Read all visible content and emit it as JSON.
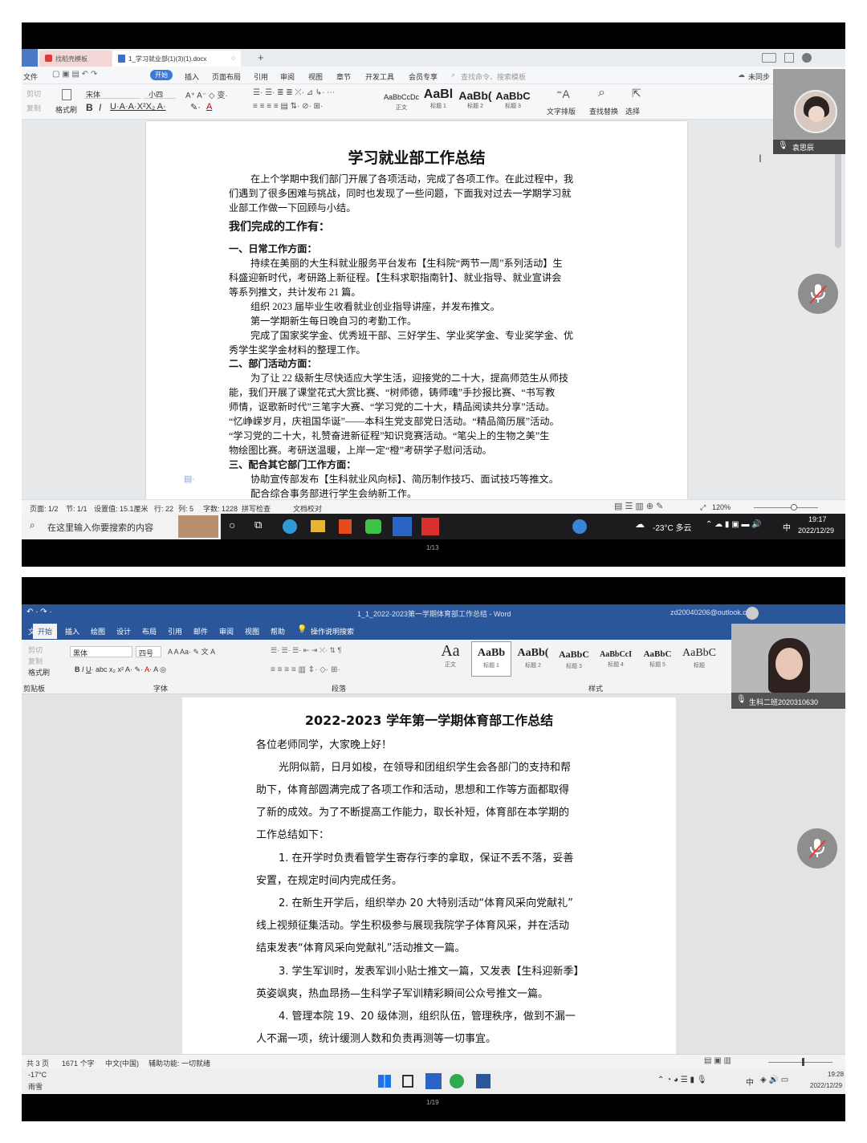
{
  "shot1": {
    "tabs": [
      {
        "label": "找稻壳模板",
        "icon": "wps-icon"
      },
      {
        "label": "1_学习就业部(1)(3)(1).docx",
        "icon": "doc-icon"
      }
    ],
    "add_tab": "+",
    "menu": [
      "文件",
      "开始",
      "插入",
      "页面布局",
      "引用",
      "审阅",
      "视图",
      "章节",
      "开发工具",
      "会员专享"
    ],
    "menu_search": "查找命令、搜索模板",
    "sync": "未同步",
    "font_name": "宋体",
    "font_size": "小四",
    "styles": [
      {
        "preview": "AaBbCcDc",
        "label": "正文"
      },
      {
        "preview": "AaBl",
        "label": "标题 1"
      },
      {
        "preview": "AaBb(",
        "label": "标题 2"
      },
      {
        "preview": "AaBbC",
        "label": "标题 3"
      }
    ],
    "tool_labels": {
      "text_layout": "文字排版",
      "find_replace": "查找替换",
      "select": "选择",
      "clipboard_cut": "剪切",
      "clipboard_copy": "复制",
      "format_brush": "格式刷"
    },
    "participant_name": "袁思辰",
    "doc": {
      "title": "学习就业部工作总结",
      "lines": [
        "在上个学期中我们部门开展了各项活动，完成了各项工作。在此过程中，我",
        "们遇到了很多困难与挑战，同时也发现了一些问题，下面我对过去一学期学习就",
        "业部工作做一下回顾与小结。",
        "我们完成的工作有：",
        "一、日常工作方面：",
        "持续在美丽的大生科就业服务平台发布【生科院“两节一周”系列活动】生",
        "科盛迎新时代，考研路上新征程。【生科求职指南针】、就业指导、就业宣讲会",
        "等系列推文，共计发布 21 篇。",
        "组织 2023 届毕业生收看就业创业指导讲座，并发布推文。",
        "第一学期新生每日晚自习的考勤工作。",
        "完成了国家奖学金、优秀班干部、三好学生、学业奖学金、专业奖学金、优",
        "秀学生奖学金材料的整理工作。",
        "二、部门活动方面：",
        "为了让 22 级新生尽快适应大学生活，迎接党的二十大，提高师范生从师技",
        "能，我们开展了课堂花式大赏比赛、“树师德，铸师魂”手抄报比赛、“书写教",
        "师情，讴歌新时代”三笔字大赛、“学习党的二十大，精品阅读共分享”活动。",
        "“忆峥嵘岁月，庆祖国华诞”——本科生党支部党日活动。“精品简历展”活动。",
        "“学习党的二十大，礼赞奋进新征程”知识竞赛活动。“笔尖上的生物之美”生",
        "物绘图比赛。考研送温暖，上岸一定“橙”考研学子慰问活动。",
        "三、配合其它部门工作方面：",
        "协助宣传部发布【生科就业风向标】、简历制作技巧、面试技巧等推文。",
        "配合综合事务部进行学生会纳新工作。"
      ]
    },
    "status": {
      "page": "页面: 1/2",
      "section": "节: 1/1",
      "setting": "设置值: 15.1厘米",
      "row": "行: 22",
      "col": "列: 5",
      "words": "字数: 1228",
      "spell": "拼写检查",
      "proof": "文档校对",
      "zoom": "120%"
    },
    "taskbar": {
      "search_placeholder": "在这里输入你要搜索的内容",
      "weather": "-23°C 多云",
      "ime": "中",
      "time": "19:17",
      "date": "2022/12/29"
    },
    "footer": "1/13"
  },
  "shot2": {
    "title_bar": "1_1_2022-2023第一学期体育部工作总结 - Word",
    "account": "zd20040206@outlook.com",
    "menu": [
      "文件",
      "开始",
      "插入",
      "绘图",
      "设计",
      "布局",
      "引用",
      "邮件",
      "审阅",
      "视图",
      "帮助",
      "操作说明搜索"
    ],
    "font_name": "黑体",
    "font_size": "四号",
    "group_labels": {
      "clipboard": "剪贴板",
      "font": "字体",
      "paragraph": "段落",
      "styles": "样式"
    },
    "clip_labels": {
      "cut": "剪切",
      "copy": "复制",
      "brush": "格式刷"
    },
    "styles": [
      {
        "preview": "Aa",
        "label": "正文"
      },
      {
        "preview": "AaBb",
        "label": "标题 1"
      },
      {
        "preview": "AaBb(",
        "label": "标题 2"
      },
      {
        "preview": "AaBbC",
        "label": "标题 3"
      },
      {
        "preview": "AaBbCcI",
        "label": "标题 4"
      },
      {
        "preview": "AaBbC",
        "label": "标题 5"
      },
      {
        "preview": "AaBbC",
        "label": "标题"
      }
    ],
    "participant_name": "生科二班2020310630",
    "doc": {
      "title": "2022-2023 学年第一学期体育部工作总结",
      "lines": [
        "各位老师同学，大家晚上好！",
        "光阴似箭，日月如梭，在领导和团组织学生会各部门的支持和帮",
        "助下，体育部圆满完成了各项工作和活动，思想和工作等方面都取得",
        "了新的成效。为了不断提高工作能力，取长补短，体育部在本学期的",
        "工作总结如下：",
        "1. 在开学时负责看管学生寄存行李的拿取，保证不丢不落，妥善",
        "安置，在规定时间内完成任务。",
        "2. 在新生开学后，组织举办 20 大特别活动“体育风采向党献礼”",
        "线上视频征集活动。学生积极参与展现我院学子体育风采，并在活动",
        "结束发表“体育风采向党献礼”活动推文一篇。",
        "3. 学生军训时，发表军训小贴士推文一篇，又发表【生科迎新季】",
        "英姿飒爽，热血昂扬—生科学子军训精彩瞬间公众号推文一篇。",
        "4. 管理本院 19、20 级体测，组织队伍，管理秩序，做到不漏一",
        "人不漏一项，统计缓测人数和负责再测等一切事宜。"
      ]
    },
    "status": {
      "pages": "共 3 页",
      "words": "1671 个字",
      "lang": "中文(中国)",
      "access": "辅助功能: 一切就绪"
    },
    "taskbar": {
      "temp": "-17°C",
      "weather": "雨雪",
      "ime": "中",
      "time": "19:28",
      "date": "2022/12/29"
    },
    "footer": "1/19"
  }
}
